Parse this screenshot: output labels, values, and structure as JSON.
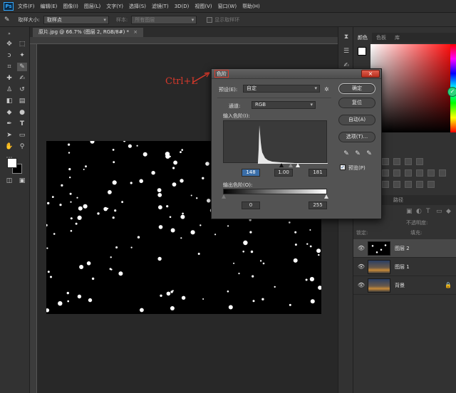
{
  "app": {
    "logo": "Ps"
  },
  "menu": [
    "文件(F)",
    "编辑(E)",
    "图像(I)",
    "图层(L)",
    "文字(Y)",
    "选择(S)",
    "滤镜(T)",
    "3D(D)",
    "视图(V)",
    "窗口(W)",
    "帮助(H)"
  ],
  "options": {
    "sample_size_label": "取样大小:",
    "sample_size_value": "取样点",
    "sample_label": "样本:",
    "sample_value": "所有图层",
    "show_ring_label": "显示取样环"
  },
  "document": {
    "tab": "原片.jpg @ 66.7% (图层 2, RGB/8#) *"
  },
  "annotation": "Ctrl+L",
  "panels": {
    "color_tabs": [
      "颜色",
      "色板",
      "库"
    ],
    "mid_tabs": [
      "路径"
    ],
    "layers": [
      {
        "name": "图层 2",
        "thumb": "stars",
        "active": true
      },
      {
        "name": "图层 1",
        "thumb": "city",
        "active": false
      },
      {
        "name": "背景",
        "thumb": "city",
        "active": false
      }
    ],
    "layer_controls": {
      "lock": "锁定:",
      "opacity": "不透明度:",
      "fill": "填充:"
    }
  },
  "levels": {
    "title": "色阶",
    "close": "×",
    "preset_label": "预设(E):",
    "preset_value": "自定",
    "channel_label": "通道:",
    "channel_value": "RGB",
    "input_label": "输入色阶(I):",
    "input_black": "148",
    "input_mid": "1.00",
    "input_white": "181",
    "output_label": "输出色阶(O):",
    "output_black": "0",
    "output_white": "255",
    "buttons": {
      "ok": "确定",
      "reset": "复位",
      "auto": "自动(A)",
      "options": "选项(T)..."
    },
    "preview_label": "预览(P)",
    "preview_checked": true
  },
  "colors": {
    "accent_red": "#d8392b",
    "selection_blue": "#3a6ea8",
    "dialog_bg": "#535353"
  }
}
